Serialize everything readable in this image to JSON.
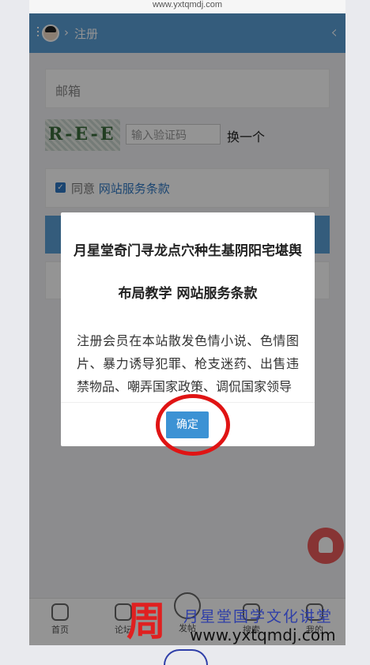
{
  "browser": {
    "url": "www.yxtqmdj.com"
  },
  "header": {
    "separator": "›",
    "title": "注册",
    "back_icon": "‹"
  },
  "form": {
    "email_placeholder": "邮箱",
    "captcha_text": "R-E-E",
    "captcha_placeholder": "输入验证码",
    "captcha_refresh": "换一个",
    "agree_label": "同意",
    "agree_link": "网站服务条款"
  },
  "tabbar": [
    "首页",
    "论坛",
    "发帖",
    "搜索",
    "我的"
  ],
  "modal": {
    "title": "月星堂奇门寻龙点穴种生基阴阳宅堪舆布局教学 网站服务条款",
    "body": "注册会员在本站散发色情小说、色情图片、暴力诱导犯罪、枪支迷药、出售违禁物品、嘲弄国家政策、调侃国家领导",
    "ok": "确定"
  },
  "watermark": {
    "logo": "周",
    "line1": "月星堂国学文化讲堂",
    "line2": "www.yxtqmdj.com"
  },
  "colors": {
    "header": "#5b9fd6",
    "link": "#2f78c3",
    "ok_button": "#3c92d4",
    "fab": "#e85b5b",
    "annotation": "#e01414"
  }
}
